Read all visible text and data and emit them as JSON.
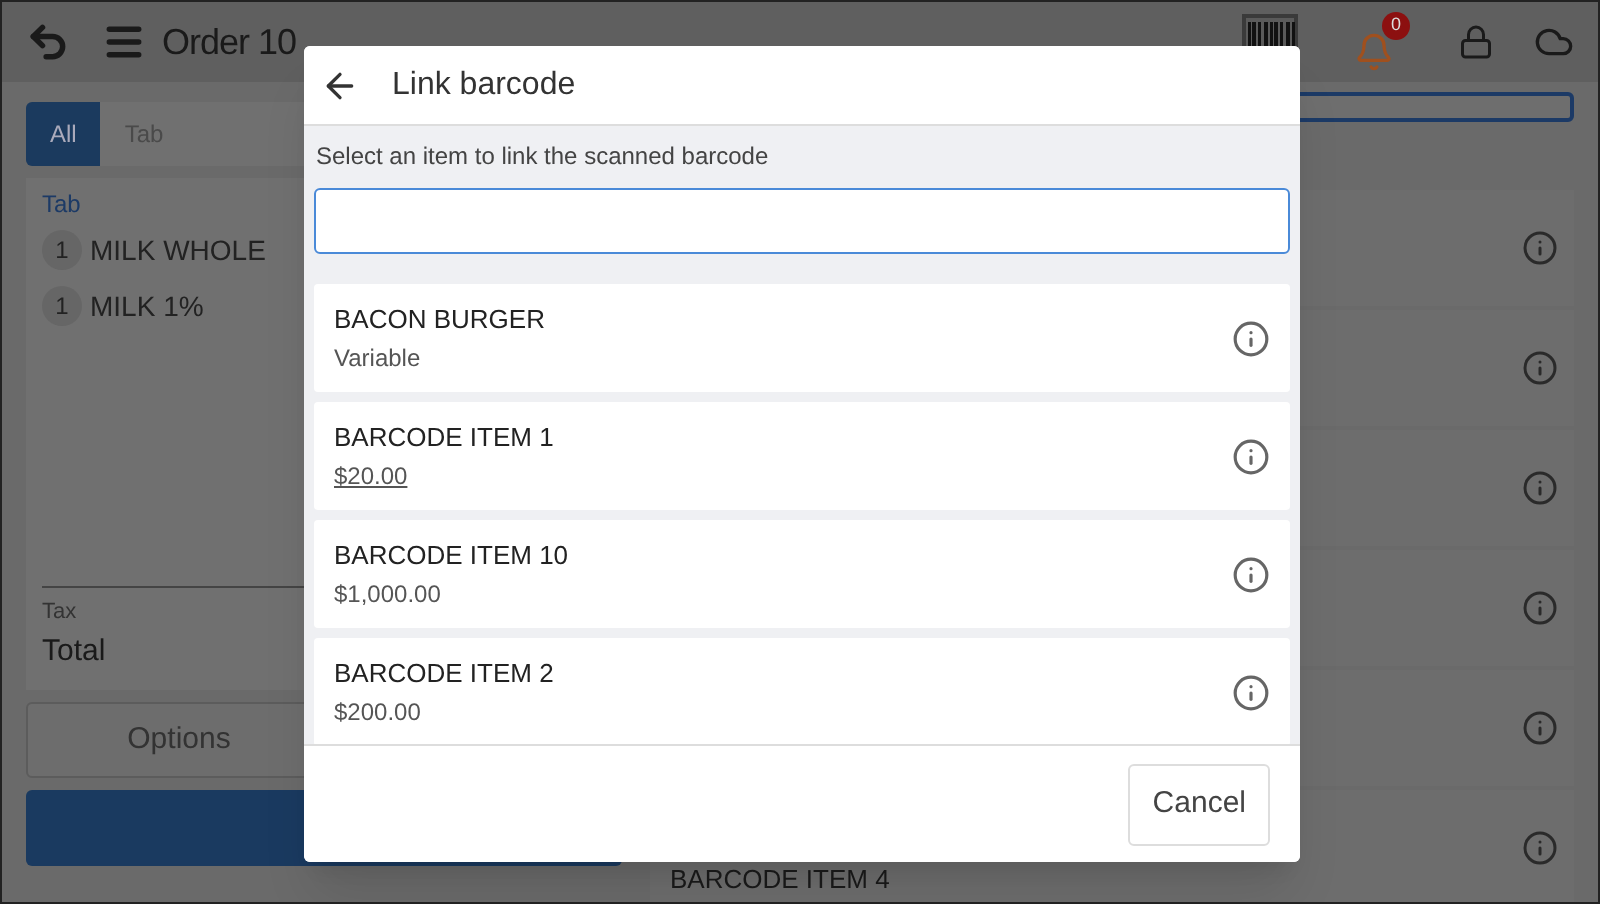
{
  "header": {
    "title": "Order 10",
    "notification_count": "0"
  },
  "order_tabs": [
    {
      "label": "All",
      "selected": true
    },
    {
      "label": "Tab",
      "selected": false
    }
  ],
  "order": {
    "section": "Tab",
    "lines": [
      {
        "qty": "1",
        "name": "MILK WHOLE"
      },
      {
        "qty": "1",
        "name": "MILK 1%"
      }
    ],
    "tax_label": "Tax",
    "total_label": "Total",
    "options_button": "Options"
  },
  "catalog": {
    "last_item": "BARCODE ITEM 4"
  },
  "dialog": {
    "title": "Link barcode",
    "instruction": "Select an item to link the scanned barcode",
    "items": [
      {
        "name": "BACON BURGER",
        "price": "Variable",
        "underlined": false
      },
      {
        "name": "BARCODE ITEM 1",
        "price": "$20.00",
        "underlined": true
      },
      {
        "name": "BARCODE ITEM 10",
        "price": "$1,000.00",
        "underlined": false
      },
      {
        "name": "BARCODE ITEM 2",
        "price": "$200.00",
        "underlined": false
      }
    ],
    "cancel": "Cancel"
  }
}
